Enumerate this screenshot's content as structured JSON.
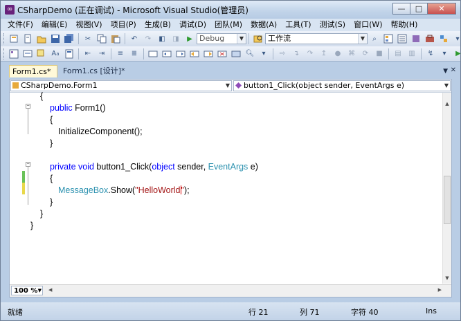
{
  "window": {
    "title": "CSharpDemo (正在调试) - Microsoft Visual Studio(管理员)",
    "minimize": "—",
    "maximize": "□",
    "close": "✕"
  },
  "menu": [
    "文件(F)",
    "编辑(E)",
    "视图(V)",
    "项目(P)",
    "生成(B)",
    "调试(D)",
    "团队(M)",
    "数据(A)",
    "工具(T)",
    "测试(S)",
    "窗口(W)",
    "帮助(H)"
  ],
  "toolbar": {
    "config_value": "Debug",
    "search_value": "工作流"
  },
  "tabs": {
    "active": "Form1.cs*",
    "inactive": "Form1.cs [设计]*"
  },
  "navbar": {
    "class_combo": "CSharpDemo.Form1",
    "member_combo": "button1_Click(object sender, EventArgs e)"
  },
  "code": {
    "line1": "{",
    "line2_kw": "public",
    "line2_rest": " Form1()",
    "line3": "{",
    "line4": "InitializeComponent();",
    "line5": "}",
    "line7_kw1": "private",
    "line7_kw2": "void",
    "line7_name": " button1_Click(",
    "line7_kw3": "object",
    "line7_mid": " sender, ",
    "line7_type": "EventArgs",
    "line7_end": " e)",
    "line8": "{",
    "line9_type": "MessageBox",
    "line9_a": ".Show(",
    "line9_str1": "\"HelloWorld",
    "line9_str2": "\"",
    "line9_end": ");",
    "line10": "}",
    "line11": "}",
    "line12": "}"
  },
  "editor_bottom": {
    "zoom": "100 %"
  },
  "status": {
    "ready": "就绪",
    "row": "行 21",
    "col": "列 71",
    "char": "字符 40",
    "mode": "Ins"
  },
  "colors": {
    "keyword": "#0000ff",
    "type": "#2b91af",
    "string": "#a31515",
    "changed_saved": "#6ac259",
    "changed_unsaved": "#e8d84a"
  },
  "icons": [
    "new-project-icon",
    "add-item-icon",
    "open-file-icon",
    "save-icon",
    "save-all-icon",
    "cut-icon",
    "copy-icon",
    "paste-icon",
    "undo-icon",
    "redo-icon",
    "navigate-backward-icon",
    "start-debugging-icon",
    "find-in-files-icon",
    "solution-explorer-icon",
    "properties-icon",
    "toolbox-icon",
    "comment-icon",
    "uncomment-icon",
    "step-into-icon",
    "step-over-icon",
    "step-out-icon",
    "breakpoint-icon"
  ]
}
